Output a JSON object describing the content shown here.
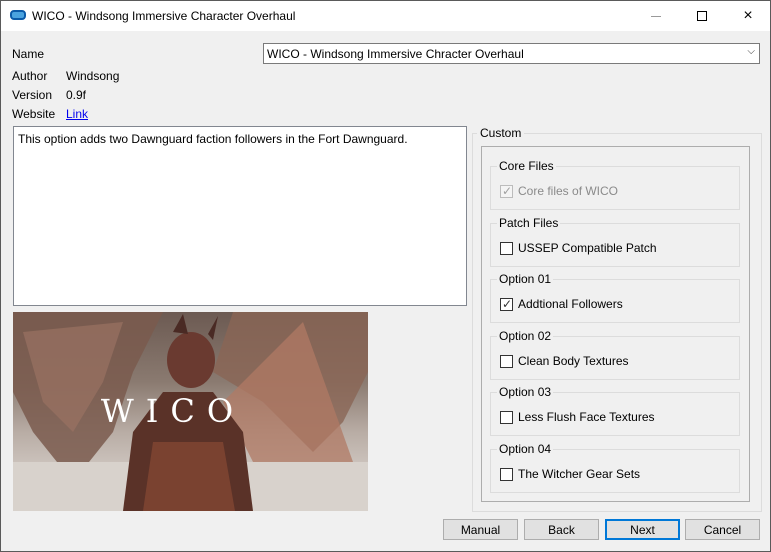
{
  "window": {
    "title": "WICO - Windsong Immersive Character Overhaul",
    "controls": {
      "minimize": "minimize",
      "maximize": "maximize",
      "close": "×"
    }
  },
  "info": {
    "name_label": "Name",
    "author_label": "Author",
    "author_value": "Windsong",
    "version_label": "Version",
    "version_value": "0.9f",
    "website_label": "Website",
    "website_link": "Link"
  },
  "name_select": {
    "value": "WICO - Windsong Immersive Chracter Overhaul"
  },
  "description": "This option adds two Dawnguard faction followers in the Fort Dawnguard.",
  "preview": {
    "logo_text": "WICO"
  },
  "custom": {
    "title": "Custom",
    "groups": [
      {
        "title": "Core Files",
        "option": "Core files of WICO",
        "checked": true,
        "disabled": true
      },
      {
        "title": "Patch Files",
        "option": "USSEP Compatible Patch",
        "checked": false,
        "disabled": false
      },
      {
        "title": "Option 01",
        "option": "Addtional Followers",
        "checked": true,
        "disabled": false
      },
      {
        "title": "Option 02",
        "option": "Clean Body Textures",
        "checked": false,
        "disabled": false
      },
      {
        "title": "Option 03",
        "option": "Less Flush Face Textures",
        "checked": false,
        "disabled": false
      },
      {
        "title": "Option 04",
        "option": "The Witcher Gear Sets",
        "checked": false,
        "disabled": false
      }
    ]
  },
  "buttons": {
    "manual": "Manual",
    "back": "Back",
    "next": "Next",
    "cancel": "Cancel"
  }
}
